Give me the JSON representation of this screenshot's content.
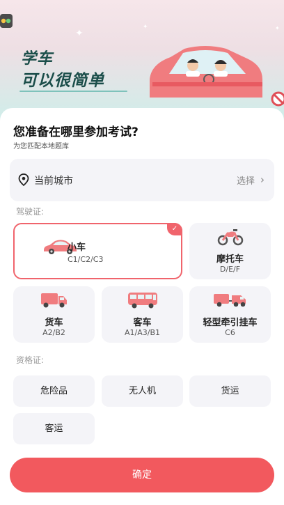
{
  "banner": {
    "slogan_line1": "学车",
    "slogan_line2": "可以很简单"
  },
  "header": {
    "title": "您准备在哪里参加考试?",
    "subtitle": "为您匹配本地题库"
  },
  "city": {
    "label": "当前城市",
    "action": "选择",
    "chevron": "›"
  },
  "license": {
    "section_label": "驾驶证:",
    "selected_index": 0,
    "items": [
      {
        "name": "小车",
        "codes": "C1/C2/C3",
        "icon": "car-icon"
      },
      {
        "name": "摩托车",
        "codes": "D/E/F",
        "icon": "motorcycle-icon"
      },
      {
        "name": "货车",
        "codes": "A2/B2",
        "icon": "truck-icon"
      },
      {
        "name": "客车",
        "codes": "A1/A3/B1",
        "icon": "bus-icon"
      },
      {
        "name": "轻型牵引挂车",
        "codes": "C6",
        "icon": "trailer-icon"
      }
    ]
  },
  "qualification": {
    "section_label": "资格证:",
    "items": [
      "危险品",
      "无人机",
      "货运",
      "客运"
    ]
  },
  "footer": {
    "confirm_label": "确定"
  },
  "colors": {
    "accent": "#f2595e",
    "tile_bg": "#f4f4f8",
    "slogan": "#1b4e4a"
  }
}
